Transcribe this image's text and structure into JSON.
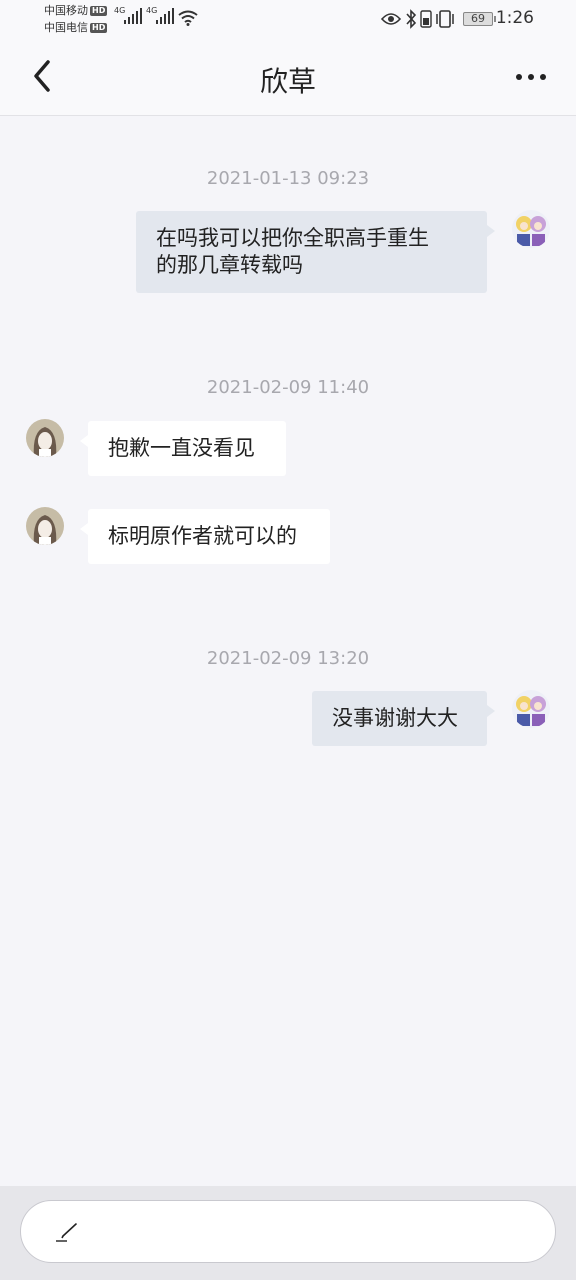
{
  "status_bar": {
    "carrier_1": "中国移动",
    "carrier_2": "中国电信",
    "hd_label": "HD",
    "network_label": "4G",
    "battery_level": "69",
    "time": "1:26",
    "icons": [
      "eye-icon",
      "bluetooth-icon",
      "vibrate-icon",
      "battery-icon",
      "wifi-icon",
      "signal-icon"
    ]
  },
  "header": {
    "title": "欣草",
    "back_icon": "chevron-left-icon",
    "more_icon": "more-dots-icon"
  },
  "messages": [
    {
      "type": "timestamp",
      "text": "2021-01-13 09:23"
    },
    {
      "type": "outgoing",
      "line1": "在吗我可以把你全职高手重生",
      "line2": "的那几章转载吗"
    },
    {
      "type": "timestamp",
      "text": "2021-02-09 11:40"
    },
    {
      "type": "incoming",
      "text": "抱歉一直没看见"
    },
    {
      "type": "incoming",
      "text": "标明原作者就可以的"
    },
    {
      "type": "timestamp",
      "text": "2021-02-09 13:20"
    },
    {
      "type": "outgoing",
      "text": "没事谢谢大大"
    }
  ],
  "composer": {
    "placeholder": "",
    "icon": "pen-icon"
  },
  "colors": {
    "background": "#f5f5f9",
    "outgoing_bubble": "#e3e7ee",
    "incoming_bubble": "#ffffff",
    "timestamp": "#a8a8ae"
  }
}
